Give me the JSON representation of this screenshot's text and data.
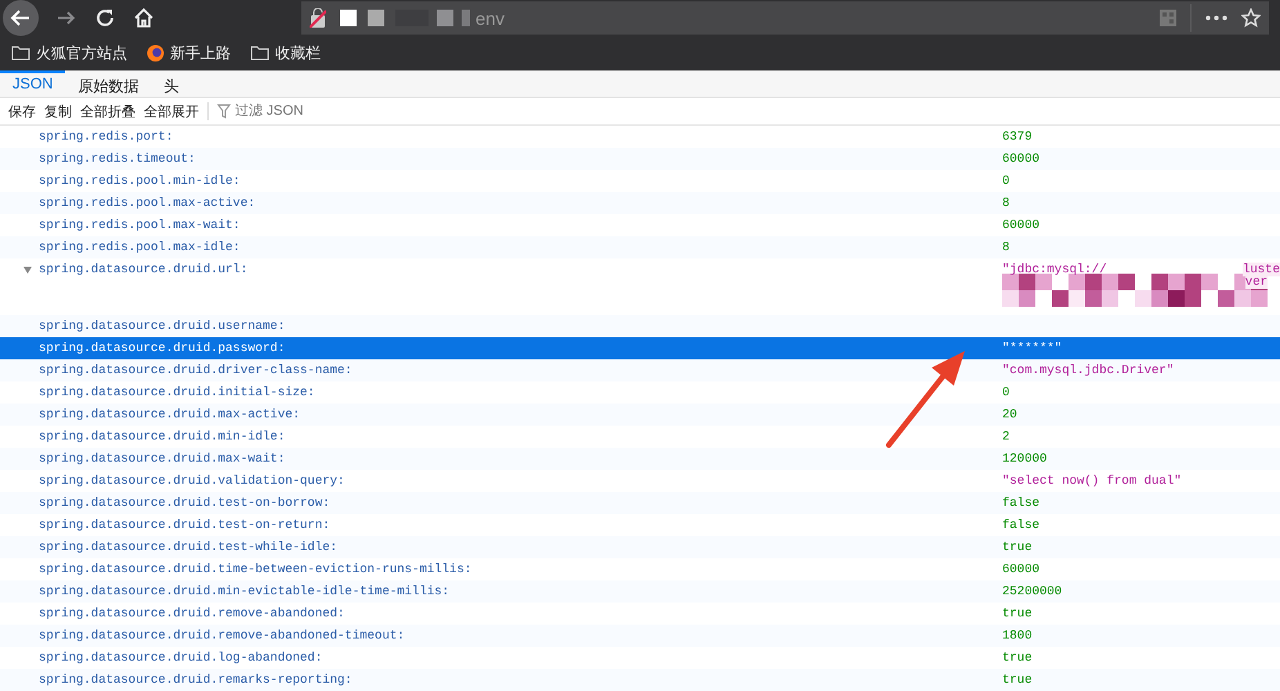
{
  "browser": {
    "address": "env",
    "bookmarks": [
      {
        "label": "火狐官方站点",
        "kind": "folder"
      },
      {
        "label": "新手上路",
        "kind": "firefox"
      },
      {
        "label": "收藏栏",
        "kind": "folder"
      }
    ]
  },
  "tabs": [
    {
      "label": "JSON",
      "selected": true
    },
    {
      "label": "原始数据",
      "selected": false
    },
    {
      "label": "头",
      "selected": false
    }
  ],
  "toolbar": {
    "buttons": [
      "保存",
      "复制",
      "全部折叠",
      "全部展开"
    ],
    "filter": {
      "placeholder": "过滤 JSON"
    }
  },
  "rows": [
    {
      "key": "spring.redis.port:",
      "value": "6379",
      "kind": "number",
      "selected": false
    },
    {
      "key": "spring.redis.timeout:",
      "value": "60000",
      "kind": "number",
      "selected": false
    },
    {
      "key": "spring.redis.pool.min-idle:",
      "value": "0",
      "kind": "number",
      "selected": false
    },
    {
      "key": "spring.redis.pool.max-active:",
      "value": "8",
      "kind": "number",
      "selected": false
    },
    {
      "key": "spring.redis.pool.max-wait:",
      "value": "60000",
      "kind": "number",
      "selected": false
    },
    {
      "key": "spring.redis.pool.max-idle:",
      "value": "8",
      "kind": "number",
      "selected": false
    },
    {
      "key": "spring.datasource.druid.url:",
      "value": "\"jdbc:mysql://",
      "kind": "redacted",
      "fragments": [
        "luste",
        "ver"
      ],
      "expanded": true,
      "selected": false
    },
    {
      "key": "spring.datasource.druid.username:",
      "kind": "empty",
      "selected": false
    },
    {
      "key": "spring.datasource.druid.password:",
      "value": "\"******\"",
      "kind": "string",
      "selected": true
    },
    {
      "key": "spring.datasource.druid.driver-class-name:",
      "value": "\"com.mysql.jdbc.Driver\"",
      "kind": "string",
      "selected": false
    },
    {
      "key": "spring.datasource.druid.initial-size:",
      "value": "0",
      "kind": "number",
      "selected": false
    },
    {
      "key": "spring.datasource.druid.max-active:",
      "value": "20",
      "kind": "number",
      "selected": false
    },
    {
      "key": "spring.datasource.druid.min-idle:",
      "value": "2",
      "kind": "number",
      "selected": false
    },
    {
      "key": "spring.datasource.druid.max-wait:",
      "value": "120000",
      "kind": "number",
      "selected": false
    },
    {
      "key": "spring.datasource.druid.validation-query:",
      "value": "\"select now() from dual\"",
      "kind": "string",
      "selected": false
    },
    {
      "key": "spring.datasource.druid.test-on-borrow:",
      "value": "false",
      "kind": "boolean",
      "selected": false
    },
    {
      "key": "spring.datasource.druid.test-on-return:",
      "value": "false",
      "kind": "boolean",
      "selected": false
    },
    {
      "key": "spring.datasource.druid.test-while-idle:",
      "value": "true",
      "kind": "boolean",
      "selected": false
    },
    {
      "key": "spring.datasource.druid.time-between-eviction-runs-millis:",
      "value": "60000",
      "kind": "number",
      "selected": false
    },
    {
      "key": "spring.datasource.druid.min-evictable-idle-time-millis:",
      "value": "25200000",
      "kind": "number",
      "selected": false
    },
    {
      "key": "spring.datasource.druid.remove-abandoned:",
      "value": "true",
      "kind": "boolean",
      "selected": false
    },
    {
      "key": "spring.datasource.druid.remove-abandoned-timeout:",
      "value": "1800",
      "kind": "number",
      "selected": false
    },
    {
      "key": "spring.datasource.druid.log-abandoned:",
      "value": "true",
      "kind": "boolean",
      "selected": false
    },
    {
      "key": "spring.datasource.druid.remarks-reporting:",
      "value": "true",
      "kind": "boolean",
      "selected": false
    }
  ]
}
